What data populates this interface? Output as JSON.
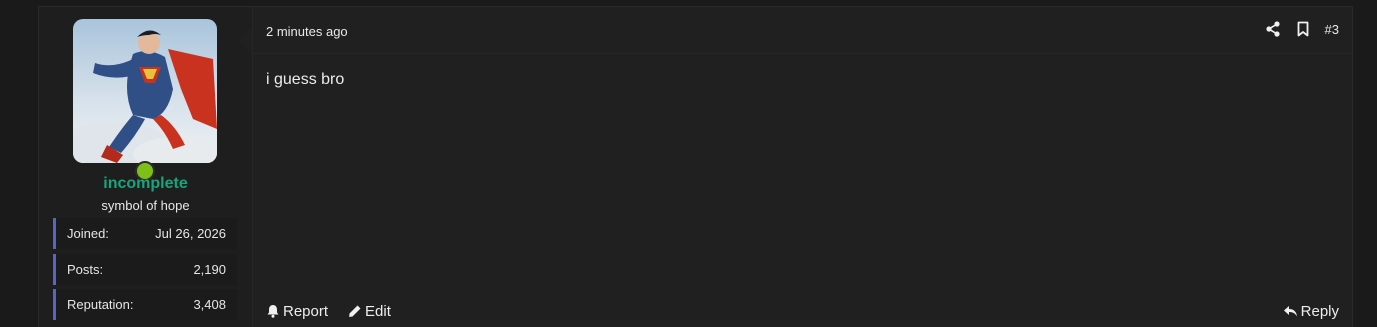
{
  "post": {
    "time": "2 minutes ago",
    "number": "#3",
    "body": "i guess bro"
  },
  "user": {
    "name": "incomplete",
    "title": "symbol of hope",
    "status": "online",
    "stats": [
      {
        "label": "Joined:",
        "value": "Jul 26, 2026"
      },
      {
        "label": "Posts:",
        "value": "2,190"
      },
      {
        "label": "Reputation:",
        "value": "3,408"
      }
    ]
  },
  "actions": {
    "report": "Report",
    "edit": "Edit",
    "reply": "Reply"
  },
  "icons": {
    "share": "share-icon",
    "bookmark": "bookmark-icon",
    "report": "bell-icon",
    "edit": "pencil-icon",
    "reply": "reply-icon"
  },
  "colors": {
    "username": "#17a57e",
    "online": "#7fbf1a",
    "stat_accent": "#5a64c8"
  }
}
